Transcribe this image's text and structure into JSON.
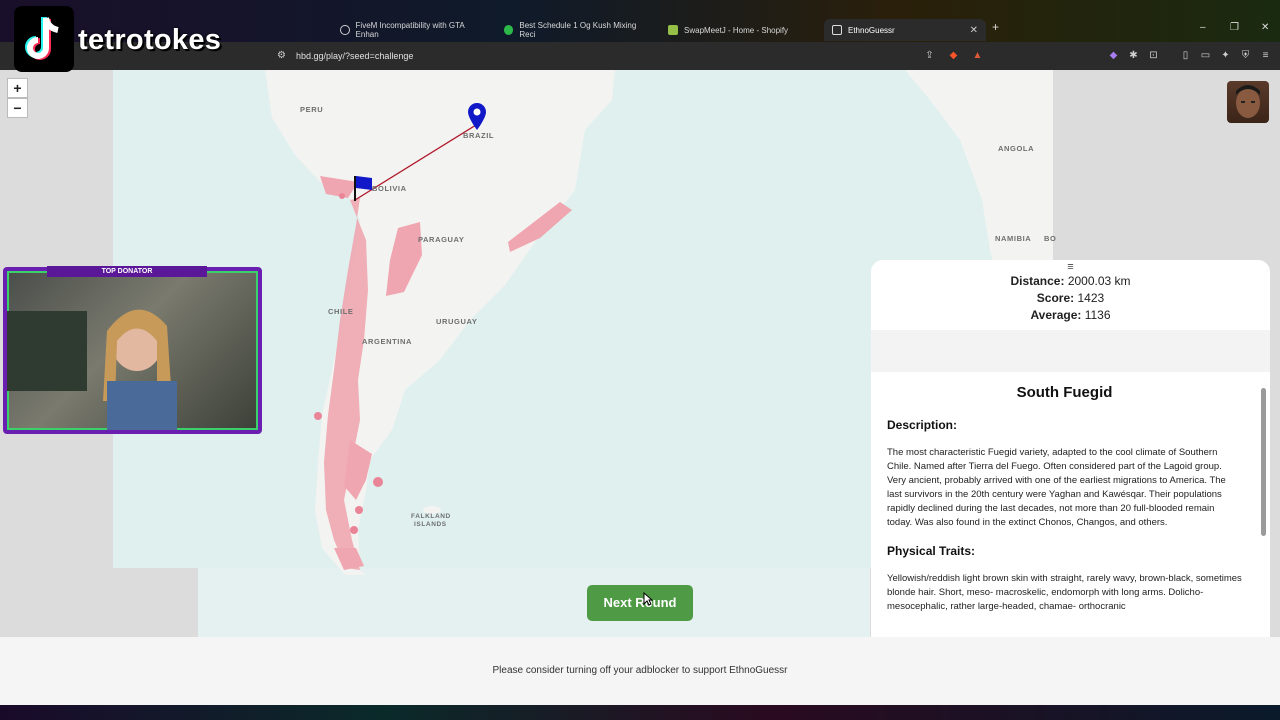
{
  "overlay": {
    "brand_name": "tetrotokes",
    "webcam_badge": "TOP DONATOR"
  },
  "browser": {
    "tabs": [
      {
        "label": "FiveM Incompatibility with GTA Enhan",
        "active": false
      },
      {
        "label": "Best Schedule 1 Og Kush Mixing Reci",
        "active": false
      },
      {
        "label": "SwapMeetJ - Home - Shopify",
        "active": false
      },
      {
        "label": "EthnoGuessr",
        "active": true
      }
    ],
    "url": "hbd.gg/play/?seed=challenge"
  },
  "map": {
    "zoom_in": "+",
    "zoom_out": "−",
    "labels": [
      "PERU",
      "BRAZIL",
      "BOLIVIA",
      "PARAGUAY",
      "CHILE",
      "ARGENTINA",
      "URUGUAY",
      "FALKLAND",
      "ISLANDS",
      "ANGOLA",
      "NAMIBIA",
      "BO"
    ],
    "guess_marker": "pin-icon",
    "answer_marker": "flag-icon",
    "region_color": "#f0a6b0",
    "line_color": "#b0182a"
  },
  "result": {
    "handle": "≡",
    "distance_label": "Distance:",
    "distance_value": "2000.03 km",
    "score_label": "Score:",
    "score_value": "1423",
    "average_label": "Average:",
    "average_value": "1136",
    "title": "South Fuegid",
    "description_heading": "Description:",
    "description_text": "The most characteristic Fuegid variety, adapted to the cool climate of Southern Chile. Named after Tierra del Fuego. Often considered part of the Lagoid group. Very ancient, probably arrived with one of the earliest migrations to America. The last survivors in the 20th century were Yaghan and Kawésqar. Their populations rapidly declined during the last decades, not more than 20 full-blooded remain today. Was also found in the extinct Chonos, Changos, and others.",
    "traits_heading": "Physical Traits:",
    "traits_text": "Yellowish/reddish light brown skin with straight, rarely wavy, brown-black, sometimes blonde hair. Short, meso- macroskelic, endomorph with long arms. Dolicho- mesocephalic, rather large-headed, chamae- orthocranic"
  },
  "actions": {
    "next_round": "Next Round"
  },
  "footer": {
    "ad_note": "Please consider turning off your adblocker to support EthnoGuessr"
  },
  "colors": {
    "accent_green": "#4e9a45",
    "overlay_purple": "#6a1fb0"
  }
}
